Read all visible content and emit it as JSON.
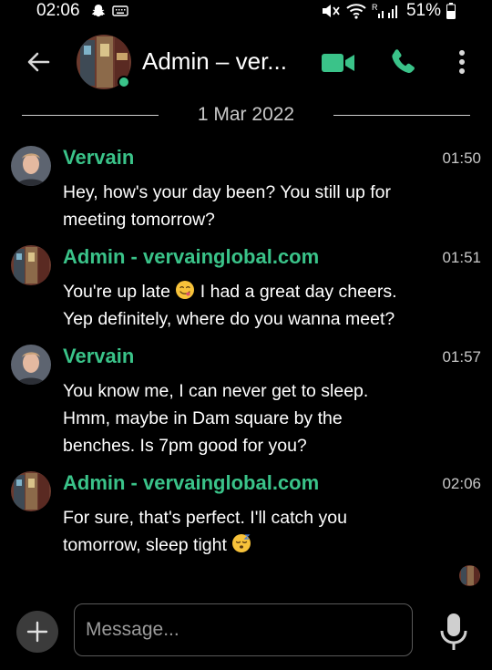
{
  "status_bar": {
    "time": "02:06",
    "battery": "51%",
    "icons": [
      "snapchat-icon",
      "keyboard-icon",
      "mute-icon",
      "wifi-icon",
      "signal-icon",
      "battery-icon"
    ]
  },
  "header": {
    "title": "Admin – ver...",
    "icons": [
      "back-arrow-icon",
      "video-call-icon",
      "phone-icon",
      "more-vert-icon"
    ]
  },
  "date_divider": "1 Mar 2022",
  "messages": [
    {
      "sender": "Vervain",
      "time": "01:50",
      "lines": [
        "Hey, how's your day been? You still up for",
        "meeting tomorrow?"
      ]
    },
    {
      "sender": "Admin - vervainglobal.com",
      "time": "01:51",
      "line1_a": "You're up late",
      "line1_b": "I had a great day cheers.",
      "line2": "Yep definitely, where do you wanna meet?",
      "emoji": "yum-face-emoji"
    },
    {
      "sender": "Vervain",
      "time": "01:57",
      "lines": [
        "You know me, I can never get to sleep.",
        "Hmm, maybe in Dam square by the",
        "benches. Is 7pm good for you?"
      ]
    },
    {
      "sender": "Admin - vervainglobal.com",
      "time": "02:06",
      "line1": "For sure, that's perfect. I'll catch you",
      "line2": "tomorrow, sleep tight",
      "emoji": "sleeping-face-emoji"
    }
  ],
  "composer": {
    "placeholder": "Message..."
  },
  "colors": {
    "accent": "#3ac389",
    "background": "#000000",
    "secondary_text": "#c8c8c8"
  }
}
